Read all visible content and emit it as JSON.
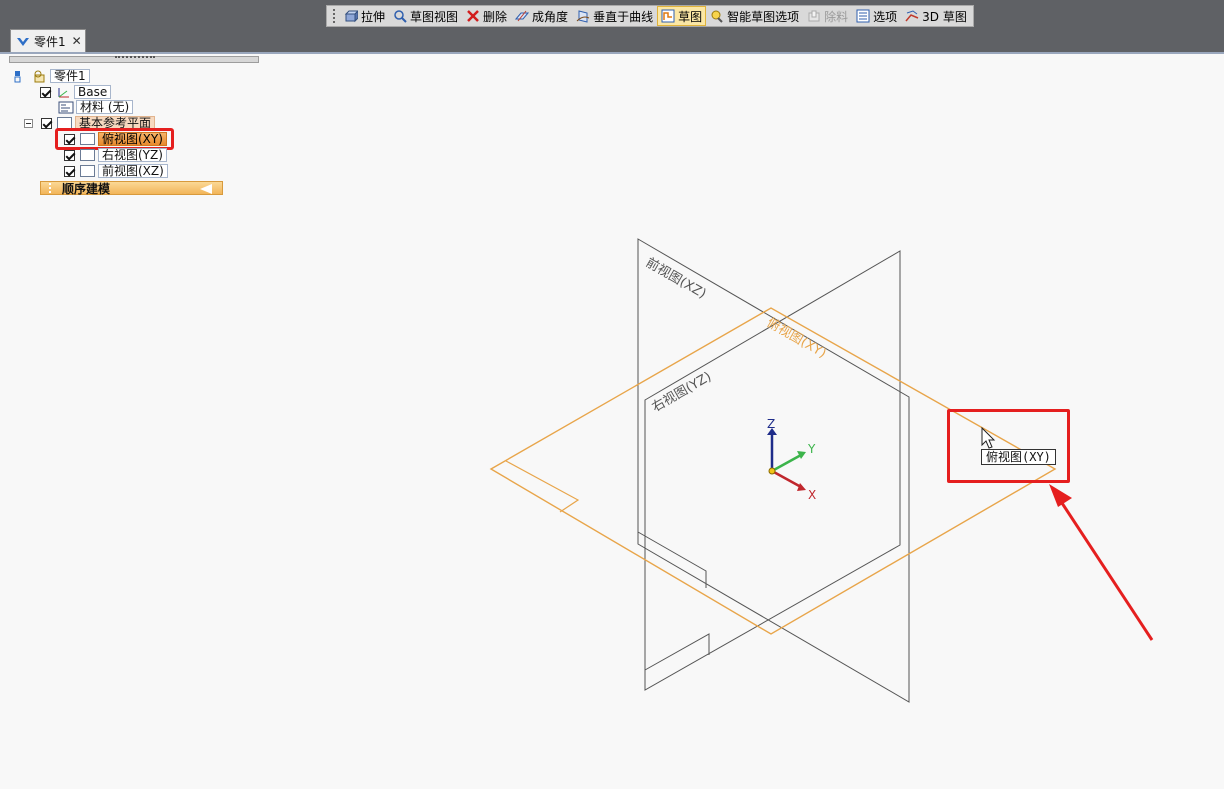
{
  "toolbar": {
    "items": [
      {
        "label": "拉伸",
        "icon": "extrude-icon"
      },
      {
        "label": "草图视图",
        "icon": "sketch-view-icon"
      },
      {
        "label": "删除",
        "icon": "delete-x-icon"
      },
      {
        "label": "成角度",
        "icon": "angled-plane-icon"
      },
      {
        "label": "垂直于曲线",
        "icon": "normal-to-curve-icon"
      },
      {
        "label": "草图",
        "icon": "sketch-icon",
        "active": true
      },
      {
        "label": "智能草图选项",
        "icon": "smart-sketch-icon"
      },
      {
        "label": "除料",
        "icon": "cut-icon",
        "disabled": true
      },
      {
        "label": "选项",
        "icon": "options-icon"
      },
      {
        "label": "3D 草图",
        "icon": "3d-sketch-icon"
      }
    ]
  },
  "document_tab": {
    "title": "零件1",
    "close": "✕"
  },
  "tree": {
    "root": "零件1",
    "base": "Base",
    "material": "材料 (无)",
    "ref_planes": "基本参考平面",
    "planes": [
      "俯视图(XY)",
      "右视图(YZ)",
      "前视图(XZ)"
    ],
    "sequential": "顺序建模"
  },
  "viewport": {
    "plane_labels": {
      "front": "前视图(XZ)",
      "right": "右视图(YZ)",
      "top": "俯视图(XY)"
    },
    "axes": {
      "x": "X",
      "y": "Y",
      "z": "Z"
    },
    "tooltip": "俯视图(XY)"
  },
  "colors": {
    "highlight_plane": "#e8a54a",
    "annotation_red": "#e51f1f",
    "axis_x": "#c0272d",
    "axis_y": "#3cb44b",
    "axis_z": "#1f2d8a"
  }
}
